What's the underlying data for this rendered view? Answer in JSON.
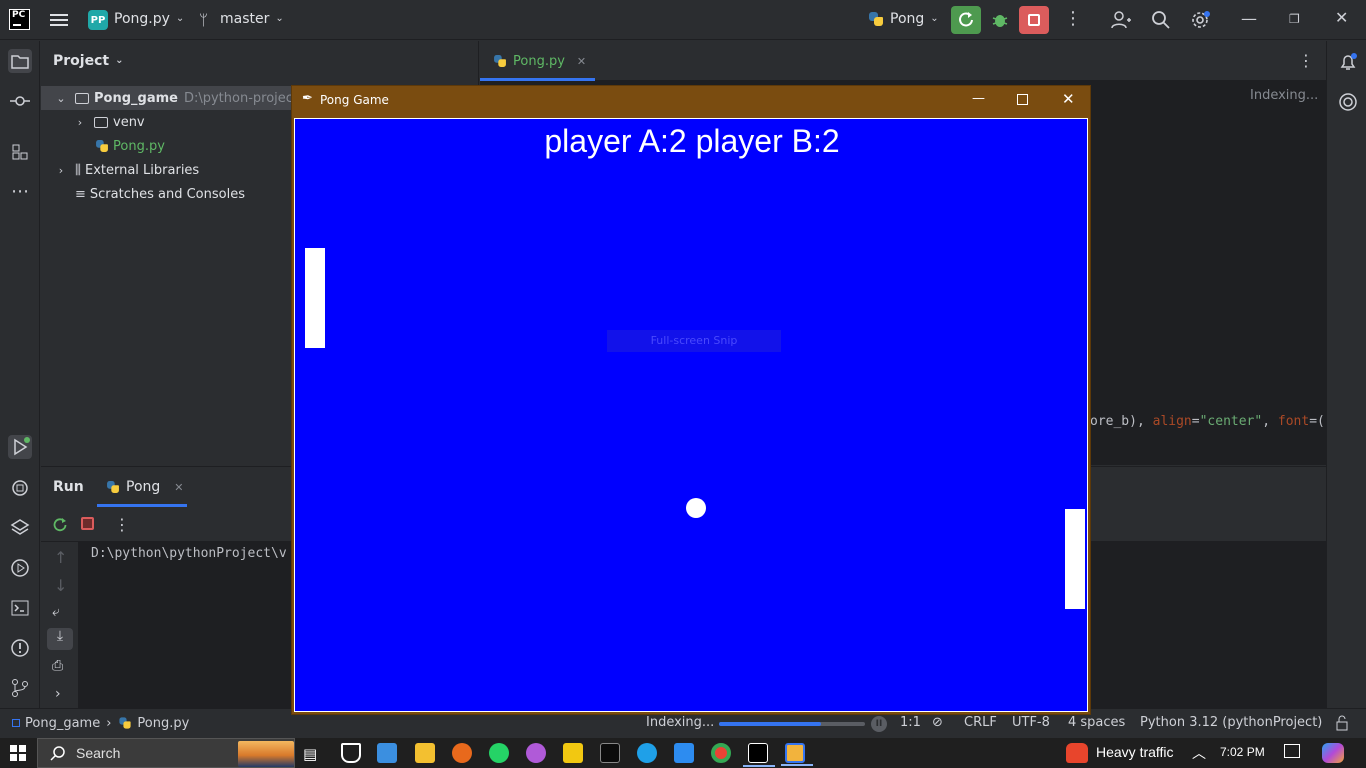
{
  "titlebar": {
    "project_badge": "PP",
    "project_name": "Pong.py",
    "branch": "master",
    "run_config": "Pong"
  },
  "project_panel": {
    "title": "Project",
    "items": [
      {
        "label": "Pong_game",
        "path": "D:\\python-project\\"
      },
      {
        "label": "venv"
      },
      {
        "label": "Pong.py"
      },
      {
        "label": "External Libraries"
      },
      {
        "label": "Scratches and Consoles"
      }
    ]
  },
  "editor": {
    "tab": "Pong.py",
    "indexing": "Indexing...",
    "code_fragment": [
      {
        "text": "ore_b), ",
        "color": "#bcbec4"
      },
      {
        "text": "align",
        "color": "#aa4926"
      },
      {
        "text": "=",
        "color": "#bcbec4"
      },
      {
        "text": "\"center\"",
        "color": "#6aab73"
      },
      {
        "text": ", ",
        "color": "#bcbec4"
      },
      {
        "text": "font",
        "color": "#aa4926"
      },
      {
        "text": "=(",
        "color": "#bcbec4"
      }
    ]
  },
  "run_panel": {
    "title": "Run",
    "tab": "Pong",
    "output": "D:\\python\\pythonProject\\v"
  },
  "status": {
    "crumb_project": "Pong_game",
    "crumb_file": "Pong.py",
    "indexing": "Indexing...",
    "progress": 0.7,
    "position": "1:1",
    "line_sep": "CRLF",
    "encoding": "UTF-8",
    "indent": "4 spaces",
    "interpreter": "Python 3.12 (pythonProject)"
  },
  "pong": {
    "title": "Pong Game",
    "score": "player A:2 player B:2",
    "snip_text": "Full-screen Snip",
    "colors": {
      "background": "#0000ff",
      "titlebar": "#7a4c10",
      "objects": "#ffffff"
    }
  },
  "taskbar": {
    "search": "Search",
    "traffic": "Heavy traffic",
    "time": "7:02 PM"
  }
}
